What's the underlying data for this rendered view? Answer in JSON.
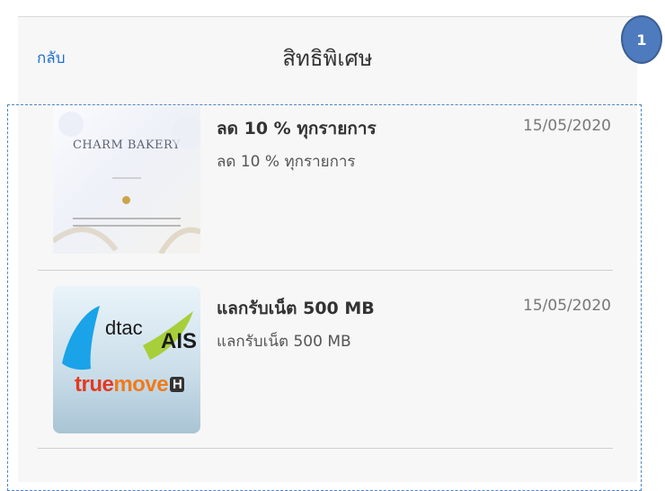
{
  "header": {
    "back_label": "กลับ",
    "title": "สิทธิพิเศษ",
    "step_badge": "1"
  },
  "items": [
    {
      "title": "ลด 10 % ทุกรายการ",
      "description": "ลด 10 % ทุกรายการ",
      "date": "15/05/2020",
      "thumbnail": {
        "brand": "CHARM BAKERY",
        "icon": "charm-bakery-logo"
      }
    },
    {
      "title": "แลกรับเน็ต 500 MB",
      "description": "แลกรับเน็ต 500 MB",
      "date": "15/05/2020",
      "thumbnail": {
        "dtac": "dtac",
        "ais": "AIS",
        "true_part": "true",
        "move_part": "move",
        "h_mark": "H",
        "icon": "telco-logos"
      }
    }
  ],
  "colors": {
    "link": "#1f6fd1",
    "badge": "#4d7bbd",
    "frame": "#4d84c7",
    "background": "#f7f7f7"
  }
}
